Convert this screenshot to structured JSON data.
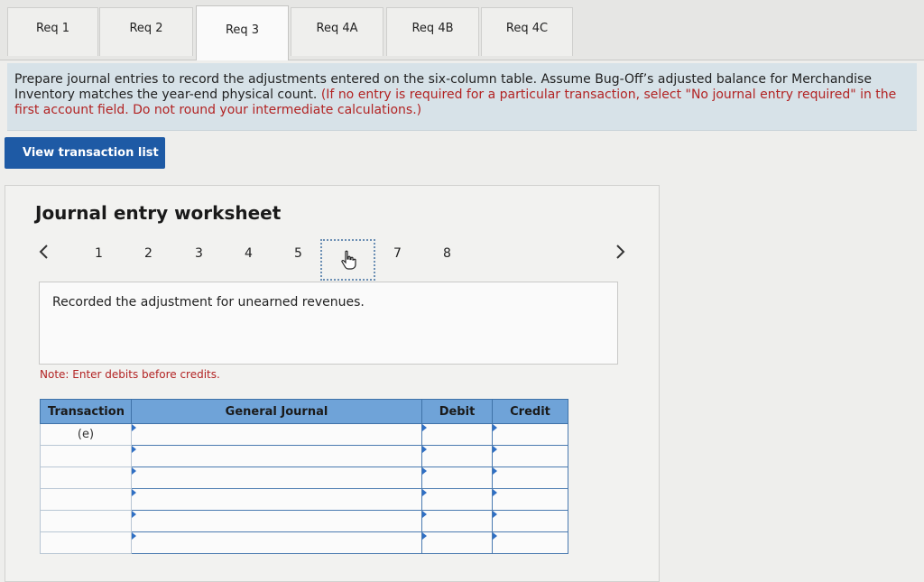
{
  "tabs": [
    {
      "label": "Req 1",
      "active": false
    },
    {
      "label": "Req 2",
      "active": false
    },
    {
      "label": "Req 3",
      "active": true
    },
    {
      "label": "Req 4A",
      "active": false
    },
    {
      "label": "Req 4B",
      "active": false
    },
    {
      "label": "Req 4C",
      "active": false
    }
  ],
  "instructions": {
    "main": "Prepare journal entries to record the adjustments entered on the six-column table. Assume Bug-Off’s adjusted balance for Merchandise Inventory matches the year-end physical count.",
    "hint": "(If no entry is required for a particular transaction, select \"No journal entry required\" in the first account field. Do not round your intermediate calculations.)"
  },
  "view_button": "View transaction list",
  "worksheet": {
    "title": "Journal entry worksheet",
    "pages": [
      "1",
      "2",
      "3",
      "4",
      "5",
      "6",
      "7",
      "8"
    ],
    "current_page": "6",
    "prev_icon": "chevron-left-icon",
    "next_icon": "chevron-right-icon",
    "cursor_icon": "hand-pointer-icon",
    "description": "Recorded the adjustment for unearned revenues.",
    "note": "Note: Enter debits before credits."
  },
  "table": {
    "headers": [
      "Transaction",
      "General Journal",
      "Debit",
      "Credit"
    ],
    "rows": [
      {
        "transaction": "(e)",
        "account": "",
        "debit": "",
        "credit": ""
      },
      {
        "transaction": "",
        "account": "",
        "debit": "",
        "credit": ""
      },
      {
        "transaction": "",
        "account": "",
        "debit": "",
        "credit": ""
      },
      {
        "transaction": "",
        "account": "",
        "debit": "",
        "credit": ""
      },
      {
        "transaction": "",
        "account": "",
        "debit": "",
        "credit": ""
      },
      {
        "transaction": "",
        "account": "",
        "debit": "",
        "credit": ""
      }
    ]
  },
  "colors": {
    "header_blue": "#6fa3d8",
    "button_blue": "#1e5aa5",
    "hint_red": "#b22323",
    "banner": "#d7e2e8"
  }
}
